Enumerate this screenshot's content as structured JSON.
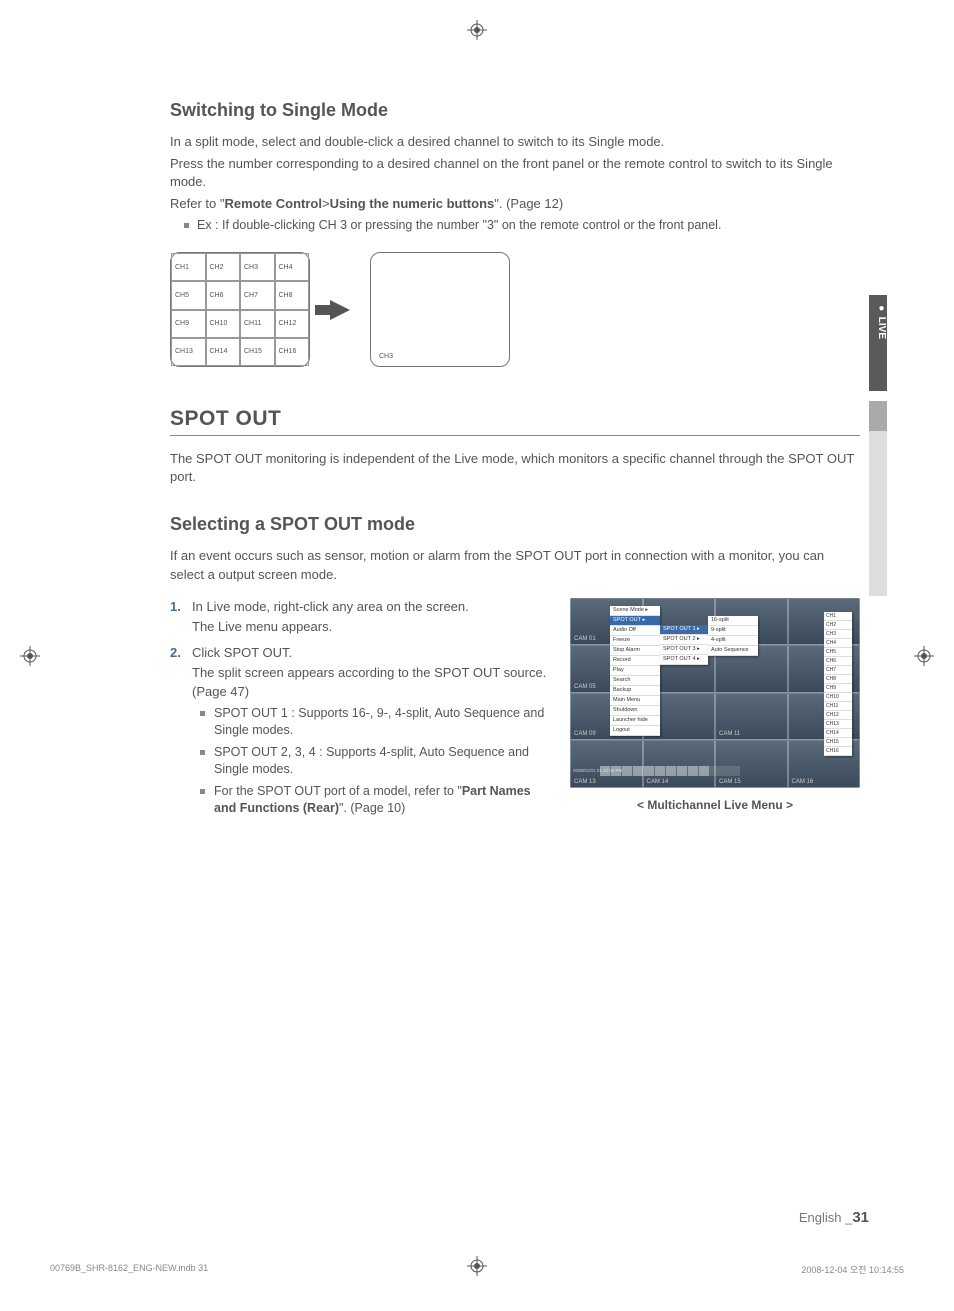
{
  "sideTab": {
    "label": "LIVE"
  },
  "section1": {
    "heading": "Switching to Single Mode",
    "body1": "In a split mode, select and double-click a desired channel to switch to its Single mode.",
    "body2": "Press the number corresponding to a desired channel on the front panel or the remote control to switch to its Single mode.",
    "ref_pre": "Refer to \"",
    "ref_b1": "Remote Control",
    "ref_sep": ">",
    "ref_b2": "Using the numeric buttons",
    "ref_post": "\". (Page 12)",
    "example": "Ex : If double-clicking CH 3 or pressing the number \"3\" on the remote control or the front panel.",
    "grid": [
      "CH1",
      "CH2",
      "CH3",
      "CH4",
      "CH5",
      "CH6",
      "CH7",
      "CH8",
      "CH9",
      "CH10",
      "CH11",
      "CH12",
      "CH13",
      "CH14",
      "CH15",
      "CH16"
    ],
    "single": "CH3"
  },
  "section2": {
    "heading": "SPOT OUT",
    "body": "The SPOT OUT monitoring is independent of the Live mode, which monitors a specific channel through the SPOT OUT port."
  },
  "section3": {
    "heading": "Selecting a SPOT OUT mode",
    "body": "If an event occurs such as sensor, motion or alarm from the SPOT OUT port in connection with a monitor, you can select a output screen mode.",
    "step1a": "In Live mode, right-click any area on the screen.",
    "step1b": "The Live menu appears.",
    "step2a": "Click SPOT OUT.",
    "step2b": "The split screen appears according to the SPOT OUT source. (Page 47)",
    "bullet1": "SPOT OUT 1 : Supports 16-, 9-, 4-split, Auto Sequence and Single modes.",
    "bullet2": "SPOT OUT 2, 3, 4 : Supports 4-split, Auto Sequence and Single modes.",
    "bullet3_pre": "For the SPOT OUT port of a model, refer to \"",
    "bullet3_bold": "Part Names and Functions (Rear)",
    "bullet3_post": "\". (Page 10)",
    "caption": "< Multichannel Live Menu >"
  },
  "screenshot": {
    "menu1": [
      "Scene Mode  ▸",
      "SPOT OUT  ▸",
      "Audio Off",
      "Freeze",
      "Stop Alarm",
      "Record",
      "Play",
      "Search",
      "Backup",
      "Main Menu",
      "Shutdown",
      "Launcher hide",
      "Logout"
    ],
    "menu1_hilite_index": 1,
    "menu2": [
      "SPOT OUT 1 ▸",
      "SPOT OUT 2 ▸",
      "SPOT OUT 3 ▸",
      "SPOT OUT 4 ▸"
    ],
    "menu2_hilite_index": 0,
    "menu3": [
      "16-split",
      "9-split",
      "4-split",
      "Auto Sequence"
    ],
    "menu4": [
      "CH1",
      "CH2",
      "CH3",
      "CH4",
      "CH5",
      "CH6",
      "CH7",
      "CH8",
      "CH9",
      "CH10",
      "CH11",
      "CH12",
      "CH13",
      "CH14",
      "CH15",
      "CH16"
    ],
    "timestamp": "2008/01/01\n01:10:25 PM",
    "header_time": "2008-01-01 01:10:25",
    "cams": [
      "CAM 01",
      "",
      "",
      "",
      "CAM 05",
      "",
      "",
      "",
      "CAM 09",
      "",
      "CAM 11",
      "",
      "CAM 13",
      "CAM 14",
      "CAM 15",
      "CAM 16"
    ]
  },
  "footer": {
    "lang": "English _",
    "page": "31"
  },
  "printline": {
    "left": "00769B_SHR-8162_ENG-NEW.indb   31",
    "right": "2008-12-04   오전 10:14:55"
  }
}
